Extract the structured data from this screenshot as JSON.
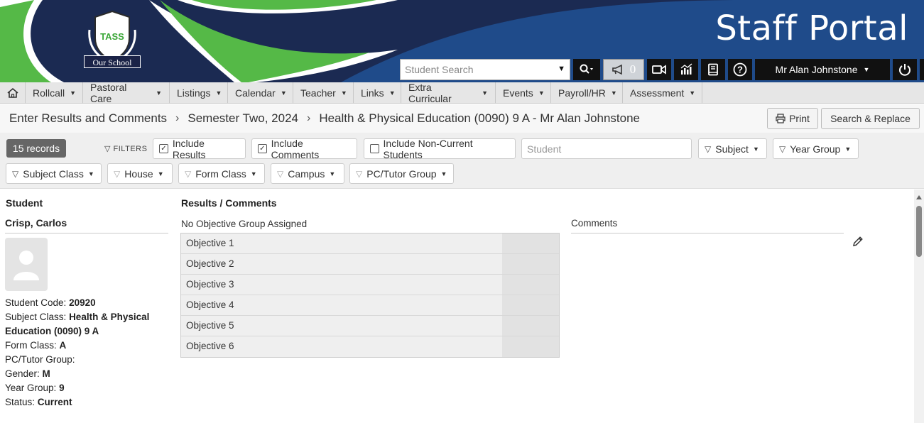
{
  "header": {
    "portal_title": "Staff Portal",
    "logo_text": "Our School",
    "logo_badge": "TASS",
    "search_placeholder": "Student Search",
    "notification_count": "0",
    "user_name": "Mr Alan Johnstone"
  },
  "nav": {
    "items": [
      "Rollcall",
      "Pastoral Care",
      "Listings",
      "Calendar",
      "Teacher",
      "Links",
      "Extra Curricular",
      "Events",
      "Payroll/HR",
      "Assessment"
    ]
  },
  "breadcrumb": {
    "items": [
      "Enter Results and Comments",
      "Semester Two, 2024",
      "Health & Physical Education (0090) 9 A - Mr Alan Johnstone"
    ],
    "print_label": "Print",
    "search_replace_label": "Search & Replace"
  },
  "filters": {
    "records": "15 records",
    "label": "FILTERS",
    "include_results": "Include Results",
    "include_comments": "Include Comments",
    "include_non_current": "Include Non-Current Students",
    "include_results_checked": true,
    "include_comments_checked": true,
    "include_non_current_checked": false,
    "student_placeholder": "Student",
    "subject": "Subject",
    "year_group": "Year Group",
    "subject_class": "Subject Class",
    "house": "House",
    "form_class": "Form Class",
    "campus": "Campus",
    "pc_tutor_group": "PC/Tutor Group"
  },
  "content": {
    "student_heading": "Student",
    "results_heading": "Results / Comments",
    "student_name": "Crisp, Carlos",
    "info": {
      "code_label": "Student Code:",
      "code": "20920",
      "class_label": "Subject Class:",
      "class": "Health & Physical Education (0090) 9 A",
      "form_label": "Form Class:",
      "form": "A",
      "pc_label": "PC/Tutor Group:",
      "pc": "",
      "gender_label": "Gender:",
      "gender": "M",
      "year_label": "Year Group:",
      "year": "9",
      "status_label": "Status:",
      "status": "Current"
    },
    "objective_group": "No Objective Group Assigned",
    "objectives": [
      "Objective 1",
      "Objective 2",
      "Objective 3",
      "Objective 4",
      "Objective 5",
      "Objective 6"
    ],
    "comments_heading": "Comments"
  }
}
